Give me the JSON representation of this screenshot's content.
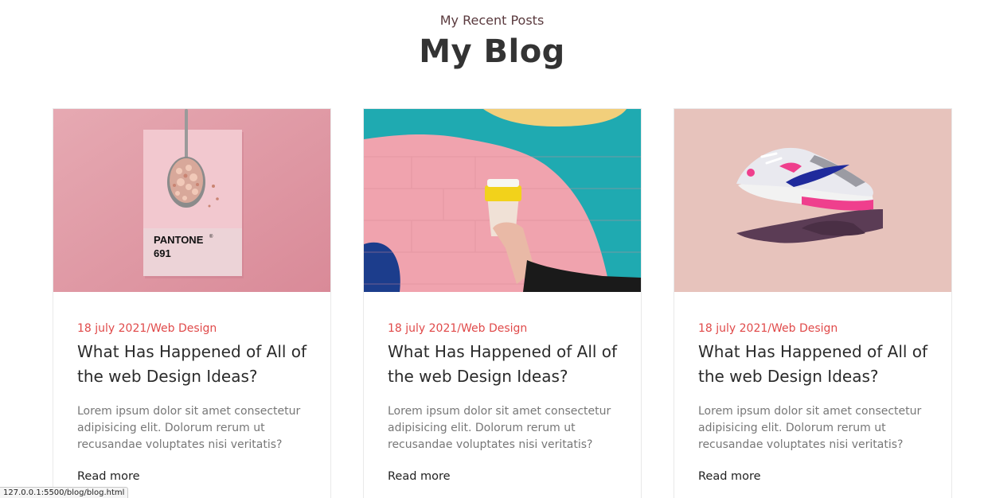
{
  "header": {
    "subtitle": "My Recent Posts",
    "title": "My Blog"
  },
  "posts": [
    {
      "meta": "18 july 2021/Web Design",
      "title": "What Has Happened of All of the web Design Ideas?",
      "excerpt": "Lorem ipsum dolor sit amet consectetur adipisicing elit. Dolorum rerum ut recusandae voluptates nisi veritatis?",
      "read_more": "Read more",
      "image": {
        "kind": "pantone-spoon",
        "text1": "PANTONE",
        "text_mark": "®",
        "text2": "691"
      }
    },
    {
      "meta": "18 july 2021/Web Design",
      "title": "What Has Happened of All of the web Design Ideas?",
      "excerpt": "Lorem ipsum dolor sit amet consectetur adipisicing elit. Dolorum rerum ut recusandae voluptates nisi veritatis?",
      "read_more": "Read more",
      "image": {
        "kind": "coffee-cup-mural"
      }
    },
    {
      "meta": "18 july 2021/Web Design",
      "title": "What Has Happened of All of the web Design Ideas?",
      "excerpt": "Lorem ipsum dolor sit amet consectetur adipisicing elit. Dolorum rerum ut recusandae voluptates nisi veritatis?",
      "read_more": "Read more",
      "image": {
        "kind": "sneaker-hand"
      }
    }
  ],
  "status_bar": {
    "url": "127.0.0.1:5500/blog/blog.html"
  },
  "colors": {
    "accent": "#e04a4a",
    "heading": "#333333",
    "subtitle": "#5a3a3e",
    "body_text": "#777777"
  }
}
